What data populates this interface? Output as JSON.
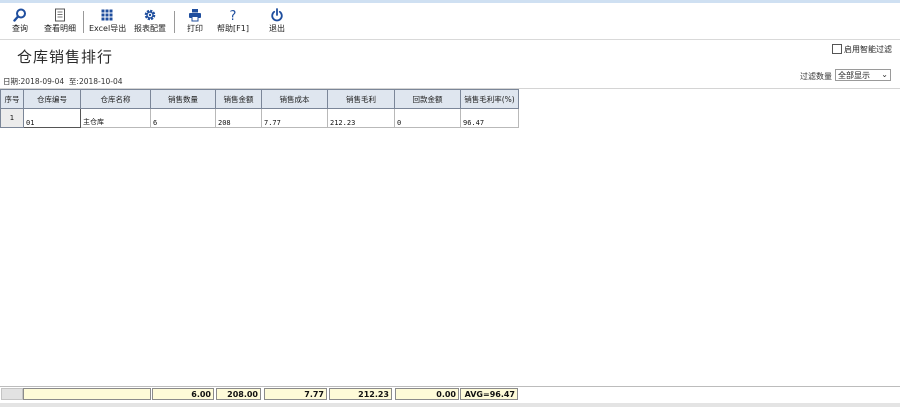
{
  "toolbar": {
    "items": [
      {
        "label": "查询",
        "icon": "search-icon"
      },
      {
        "label": "查看明细",
        "icon": "document-icon"
      },
      {
        "label": "Excel导出",
        "icon": "grid-icon"
      },
      {
        "label": "报表配置",
        "icon": "gear-icon"
      },
      {
        "label": "打印",
        "icon": "printer-icon"
      },
      {
        "label": "帮助[F1]",
        "icon": "question-icon"
      },
      {
        "label": "退出",
        "icon": "power-icon"
      }
    ]
  },
  "page": {
    "title": "仓库销售排行",
    "smart_filter_label": "启用智能过滤",
    "smart_filter_checked": false,
    "date_label": "日期:",
    "date_from": "2018-09-04",
    "date_to_label": "至:",
    "date_to": "2018-10-04",
    "filter_count_label": "过滤数量",
    "filter_count_value": "全部显示"
  },
  "table": {
    "columns": [
      "序号",
      "仓库编号",
      "仓库名称",
      "销售数量",
      "销售金额",
      "销售成本",
      "销售毛利",
      "回款金额",
      "销售毛利率(%)"
    ],
    "rows": [
      {
        "index": "1",
        "code": "01",
        "name": "主仓库",
        "qty": "6",
        "amount": "208",
        "cost": "7.77",
        "profit": "212.23",
        "payback": "0",
        "margin": "96.47"
      }
    ]
  },
  "footer": {
    "qty": "6.00",
    "amount": "208.00",
    "cost": "7.77",
    "profit": "212.23",
    "payback": "0.00",
    "margin": "AVG=96.47"
  },
  "colors": {
    "header_bg": "#dfe6ef",
    "footer_bg": "#fefbd8",
    "icon_blue": "#1f4e9e"
  }
}
